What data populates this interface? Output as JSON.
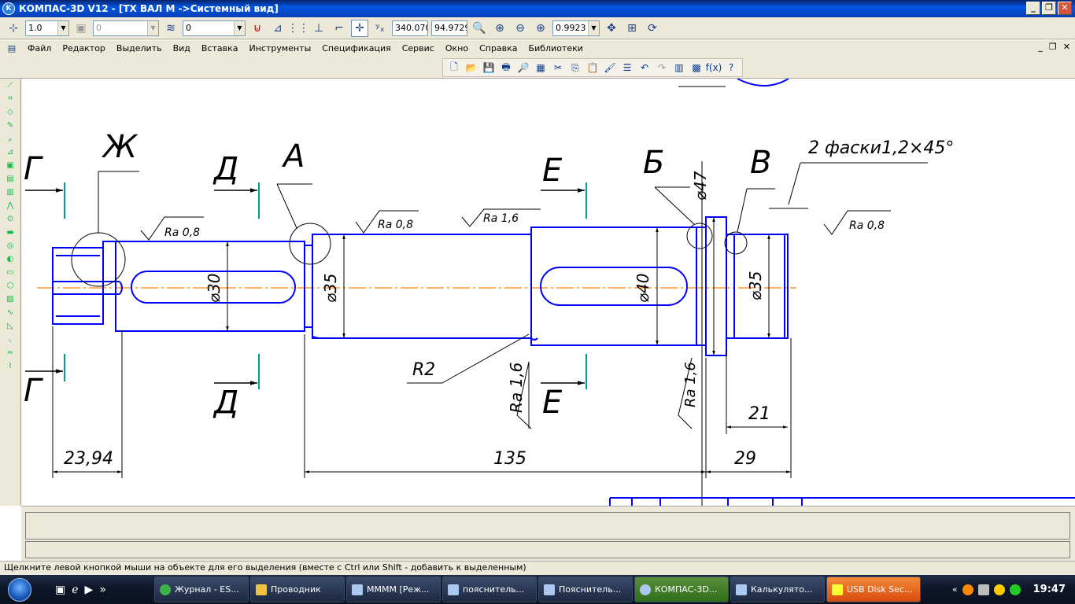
{
  "window": {
    "title": "КОМПАС-3D V12 - [ТХ ВАЛ М ->Системный вид]",
    "app_icon_text": "K"
  },
  "toolbar": {
    "step_value": "1.0",
    "layer_value": "0",
    "style_value": "0",
    "coord_x": "340.070",
    "coord_y": "94.9729",
    "zoom_value": "0.9923"
  },
  "menu": [
    "Файл",
    "Редактор",
    "Выделить",
    "Вид",
    "Вставка",
    "Инструменты",
    "Спецификация",
    "Сервис",
    "Окно",
    "Справка",
    "Библиотеки"
  ],
  "drawing": {
    "section_labels": {
      "g_top": "Г",
      "g_bottom": "Г",
      "zh": "Ж",
      "d_top": "Д",
      "d_bottom": "Д",
      "a": "А",
      "e_top": "Е",
      "e_bottom": "Е",
      "b": "Б",
      "v": "В"
    },
    "chamfer_note": "2 фаски1,2×45°",
    "roughness": {
      "r1": "Ra 0,8",
      "r2": "Ra 0,8",
      "r3": "Ra 1,6",
      "r4": "Ra 0,8",
      "r5": "Ra 1,6",
      "r6": "Ra 1,6"
    },
    "diameters": {
      "d30": "⌀30",
      "d35a": "⌀35",
      "d40": "⌀40",
      "d35b": "⌀35",
      "d47": "⌀47"
    },
    "radius": "R2",
    "dimensions": {
      "dim_2394": "23,94",
      "dim_135": "135",
      "dim_29": "29",
      "dim_21": "21"
    },
    "colors": {
      "part": "#0000ff",
      "axis": "#ff8000",
      "cut": "#009999",
      "annotation": "#000000"
    }
  },
  "status_text": "Щелкните левой кнопкой мыши на объекте для его выделения (вместе с Ctrl или Shift - добавить к выделенным)",
  "taskbar": {
    "tasks": [
      "Журнал - ES...",
      "Проводник",
      "ММММ [Реж...",
      "пояснитель...",
      "Пояснитель...",
      "КОМПАС-3D...",
      "Калькулято...",
      "USB Disk Sec..."
    ],
    "clock": "19:47"
  }
}
